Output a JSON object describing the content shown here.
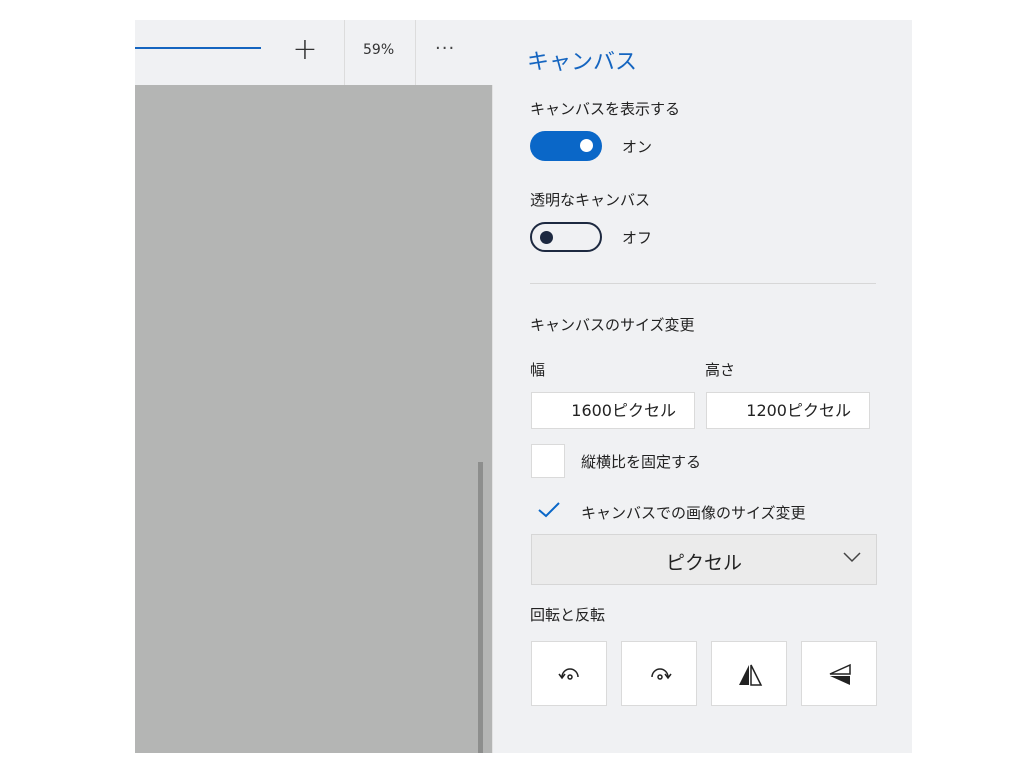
{
  "toolbar": {
    "zoom_level": "59%",
    "zoom_in_icon": "plus-icon",
    "more_icon": "ellipsis-icon"
  },
  "panel": {
    "title": "キャンバス",
    "show_canvas": {
      "label": "キャンバスを表示する",
      "state": "オン",
      "on": true
    },
    "transparent_canvas": {
      "label": "透明なキャンバス",
      "state": "オフ",
      "on": false
    },
    "resize": {
      "heading": "キャンバスのサイズ変更",
      "width_label": "幅",
      "height_label": "高さ",
      "width_value": "1600ピクセル",
      "height_value": "1200ピクセル",
      "lock_aspect": {
        "label": "縦横比を固定する",
        "checked": false
      },
      "resize_image": {
        "label": "キャンバスでの画像のサイズ変更",
        "checked": true
      },
      "unit": "ピクセル"
    },
    "rotate_flip": {
      "heading": "回転と反転",
      "buttons": [
        "rotate-left-icon",
        "rotate-right-icon",
        "flip-horizontal-icon",
        "flip-vertical-icon"
      ]
    }
  },
  "colors": {
    "accent": "#0a67c8",
    "title": "#1565c0",
    "canvas": "#b4b5b4",
    "panel_bg": "#f0f1f3"
  }
}
